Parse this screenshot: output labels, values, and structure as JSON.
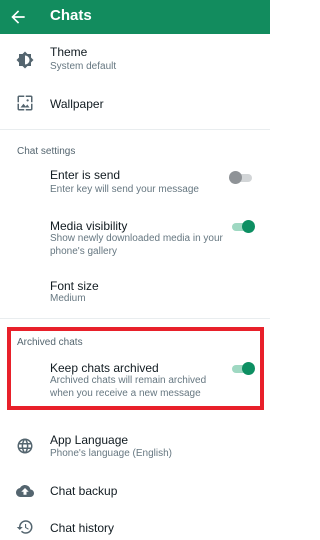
{
  "appbar": {
    "title": "Chats",
    "back_icon": "arrow-left-icon",
    "color": "#128c5e"
  },
  "display": {
    "theme": {
      "label": "Theme",
      "sub": "System default",
      "icon": "brightness-icon"
    },
    "wallpaper": {
      "label": "Wallpaper",
      "icon": "wallpaper-icon"
    }
  },
  "chat_settings": {
    "header": "Chat settings",
    "enter_is_send": {
      "label": "Enter is send",
      "sub": "Enter key will send your message",
      "enabled": false
    },
    "media_visibility": {
      "label": "Media visibility",
      "sub": "Show newly downloaded media in your phone's gallery",
      "enabled": true
    },
    "font_size": {
      "label": "Font size",
      "sub": "Medium"
    }
  },
  "archived_chats": {
    "header": "Archived chats",
    "keep_archived": {
      "label": "Keep chats archived",
      "sub": "Archived chats will remain archived when you receive a new message",
      "enabled": true
    },
    "highlight_color": "#e8202a"
  },
  "more": {
    "app_language": {
      "label": "App Language",
      "sub": "Phone's language (English)",
      "icon": "globe-icon"
    },
    "chat_backup": {
      "label": "Chat backup",
      "icon": "cloud-upload-icon"
    },
    "chat_history": {
      "label": "Chat history",
      "icon": "history-icon"
    }
  },
  "colors": {
    "accent": "#0d8f62",
    "toggle_track_on": "#9fd8c2",
    "toggle_off": "#8f9397"
  }
}
